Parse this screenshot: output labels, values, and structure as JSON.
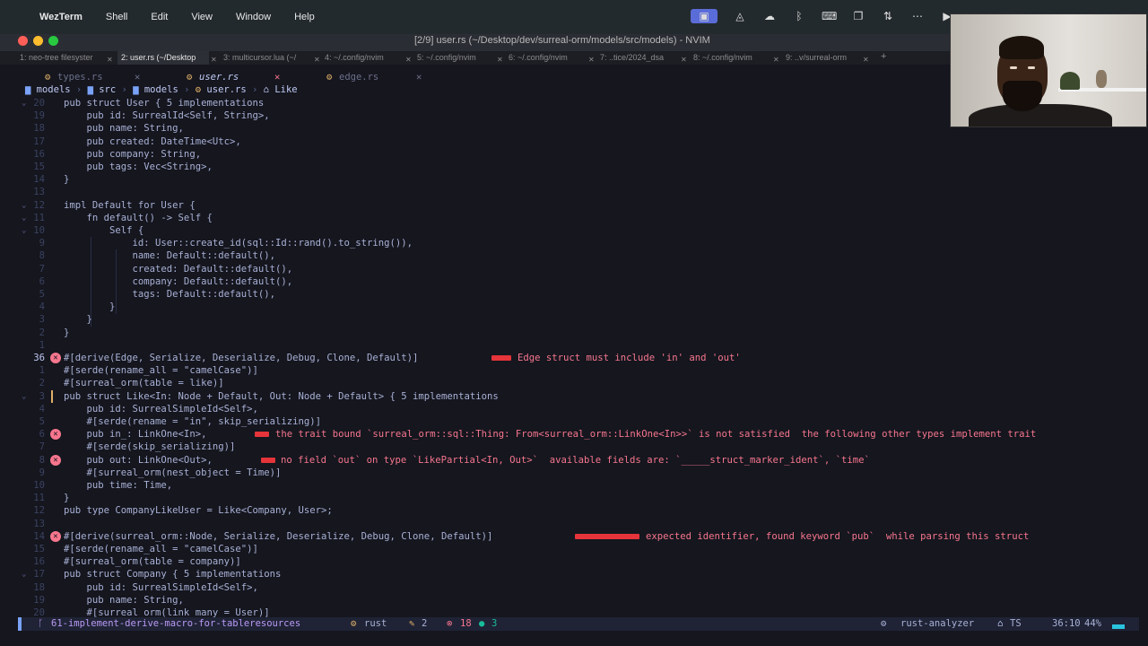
{
  "menubar": {
    "app": "WezTerm",
    "items": [
      "Shell",
      "Edit",
      "View",
      "Window",
      "Help"
    ]
  },
  "window": {
    "title": "[2/9] user.rs (~/Desktop/dev/surreal-orm/models/src/models) - NVIM"
  },
  "terminal_tabs": [
    {
      "label": "1: neo-tree filesyster",
      "active": false
    },
    {
      "label": "2: user.rs (~/Desktop",
      "active": true
    },
    {
      "label": "3: multicursor.lua (~/",
      "active": false
    },
    {
      "label": "4: ~/.config/nvim",
      "active": false
    },
    {
      "label": "5: ~/.config/nvim",
      "active": false
    },
    {
      "label": "6: ~/.config/nvim",
      "active": false
    },
    {
      "label": "7: ..tice/2024_dsa",
      "active": false
    },
    {
      "label": "8: ~/.config/nvim",
      "active": false
    },
    {
      "label": "9: ..v/surreal-orm",
      "active": false
    }
  ],
  "buffers": [
    {
      "name": "types.rs",
      "active": false
    },
    {
      "name": "user.rs",
      "active": true
    },
    {
      "name": "edge.rs",
      "active": false
    }
  ],
  "breadcrumb": [
    "models",
    "src",
    "models",
    "user.rs",
    "Like"
  ],
  "code_lines": [
    {
      "num": "20",
      "text": "pub struct User { 5 implementations"
    },
    {
      "num": "19",
      "text": "    pub id: SurrealId<Self, String>,"
    },
    {
      "num": "18",
      "text": "    pub name: String,"
    },
    {
      "num": "17",
      "text": "    pub created: DateTime<Utc>,"
    },
    {
      "num": "16",
      "text": "    pub company: String,"
    },
    {
      "num": "15",
      "text": "    pub tags: Vec<String>,"
    },
    {
      "num": "14",
      "text": "}"
    },
    {
      "num": "13",
      "text": ""
    },
    {
      "num": "12",
      "text": "impl Default for User {"
    },
    {
      "num": "11",
      "text": "    fn default() -> Self {"
    },
    {
      "num": "10",
      "text": "        Self {"
    },
    {
      "num": "9",
      "text": "            id: User::create_id(sql::Id::rand().to_string()),"
    },
    {
      "num": "8",
      "text": "            name: Default::default(),"
    },
    {
      "num": "7",
      "text": "            created: Default::default(),"
    },
    {
      "num": "6",
      "text": "            company: Default::default(),"
    },
    {
      "num": "5",
      "text": "            tags: Default::default(),"
    },
    {
      "num": "4",
      "text": "        }"
    },
    {
      "num": "3",
      "text": "    }"
    },
    {
      "num": "2",
      "text": "}"
    },
    {
      "num": "1",
      "text": ""
    },
    {
      "num": "36",
      "text": "#[derive(Edge, Serialize, Deserialize, Debug, Clone, Default)]"
    },
    {
      "num": "1",
      "text": "#[serde(rename_all = \"camelCase\")]"
    },
    {
      "num": "2",
      "text": "#[surreal_orm(table = like)]"
    },
    {
      "num": "3",
      "text": "pub struct Like<In: Node + Default, Out: Node + Default> { 5 implementations"
    },
    {
      "num": "4",
      "text": "    pub id: SurrealSimpleId<Self>,"
    },
    {
      "num": "5",
      "text": "    #[serde(rename = \"in\", skip_serializing)]"
    },
    {
      "num": "6",
      "text": "    pub in_: LinkOne<In>,"
    },
    {
      "num": "7",
      "text": "    #[serde(skip_serializing)]"
    },
    {
      "num": "8",
      "text": "    pub out: LinkOne<Out>,"
    },
    {
      "num": "9",
      "text": "    #[surreal_orm(nest_object = Time)]"
    },
    {
      "num": "10",
      "text": "    pub time: Time,"
    },
    {
      "num": "11",
      "text": "}"
    },
    {
      "num": "12",
      "text": "pub type CompanyLikeUser = Like<Company, User>;"
    },
    {
      "num": "13",
      "text": ""
    },
    {
      "num": "14",
      "text": "#[derive(surreal_orm::Node, Serialize, Deserialize, Debug, Clone, Default)]"
    },
    {
      "num": "15",
      "text": "#[serde(rename_all = \"camelCase\")]"
    },
    {
      "num": "16",
      "text": "#[surreal_orm(table = company)]"
    },
    {
      "num": "17",
      "text": "pub struct Company { 5 implementations"
    },
    {
      "num": "18",
      "text": "    pub id: SurrealSimpleId<Self>,"
    },
    {
      "num": "19",
      "text": "    pub name: String,"
    },
    {
      "num": "20",
      "text": "    #[surreal_orm(link_many = User)]"
    }
  ],
  "diagnostics": {
    "d1": "Edge struct must include 'in' and 'out'",
    "d2": "the trait bound `surreal_orm::sql::Thing: From<surreal_orm::LinkOne<In>>` is not satisfied  the following other types implement trait",
    "d3": "no field `out` on type `LikePartial<In, Out>`  available fields are: `_____struct_marker_ident`, `time`",
    "d4": "expected identifier, found keyword `pub`  while parsing this struct"
  },
  "statusline": {
    "branch": "61-implement-derive-macro-for-tableresources",
    "filetype": "rust",
    "changes": "2",
    "errors": "18",
    "hints": "3",
    "lsp": "rust-analyzer",
    "ts": "TS",
    "position": "36:10",
    "percent": "44%"
  },
  "colors": {
    "accent": "#7aa2f7",
    "error": "#f7768e",
    "background": "#15161e"
  }
}
